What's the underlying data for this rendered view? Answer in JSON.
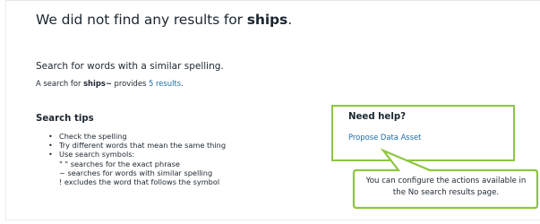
{
  "no_results": {
    "heading_prefix": "We did not find any results for ",
    "query": "ships",
    "heading_suffix": "."
  },
  "similar": {
    "title": "Search for words with a similar spelling.",
    "line_prefix": "A search for ",
    "fuzzy_query": "ships~",
    "line_mid": " provides ",
    "results_link": "5 results",
    "line_suffix": "."
  },
  "tips": {
    "title": "Search tips",
    "items": [
      "Check the spelling",
      "Try different words that mean the same thing",
      "Use search symbols:"
    ],
    "symbols": [
      "\" \" searches for the exact phrase",
      "~ searches for words with similar spelling",
      "! excludes the word that follows the symbol"
    ]
  },
  "help": {
    "title": "Need help?",
    "link": "Propose Data Asset"
  },
  "callout": {
    "line1": "You can configure the actions available in",
    "line2": "the No search results page.",
    "border_color": "#8dc63f"
  },
  "colors": {
    "text": "#1c2630",
    "link": "#1a6ea8",
    "highlight": "#8dc63f"
  }
}
